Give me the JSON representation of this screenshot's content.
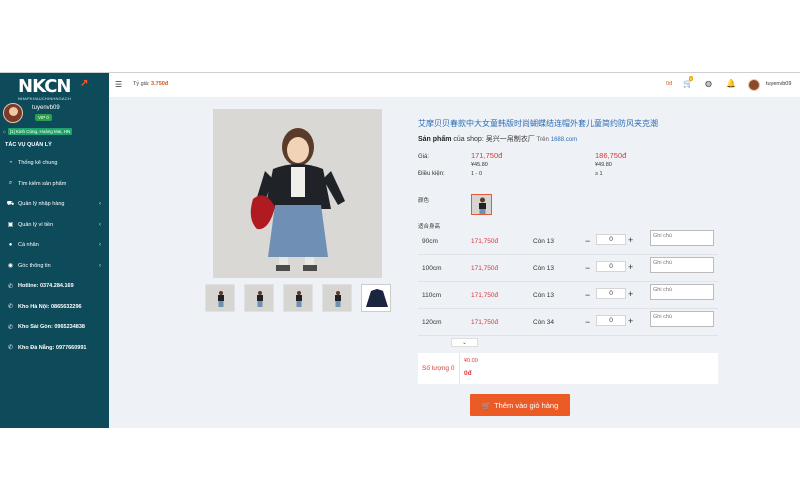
{
  "sidebar": {
    "logo_text": "NKCN",
    "logo_sub": "NHAPKHAUCHINHNGACH",
    "username": "tuyenvb09",
    "vip": "VIP 0",
    "location_tag": "[1] Kinh Cùng, Hoàng Mai, HN",
    "section_title": "TÁC VỤ QUẢN LÝ",
    "items": [
      {
        "label": "Thống kê chung",
        "icon": "dashboard-icon",
        "glyph": "◔",
        "chevron": false
      },
      {
        "label": "Tìm kiếm sản phẩm",
        "icon": "search-icon",
        "glyph": "⌕",
        "chevron": false
      },
      {
        "label": "Quản lý nhập hàng",
        "icon": "cart-icon",
        "glyph": "⛟",
        "chevron": true
      },
      {
        "label": "Quản lý ví tiền",
        "icon": "wallet-icon",
        "glyph": "▣",
        "chevron": true
      },
      {
        "label": "Cá nhân",
        "icon": "user-icon",
        "glyph": "●",
        "chevron": true
      },
      {
        "label": "Góc thông tin",
        "icon": "info-icon",
        "glyph": "◉",
        "chevron": true
      },
      {
        "label": "Hotline: 0374.284.169",
        "icon": "phone-icon",
        "glyph": "✆",
        "chevron": false
      },
      {
        "label": "Kho Hà Nội: 0865632296",
        "icon": "phone-icon",
        "glyph": "✆",
        "chevron": false
      },
      {
        "label": "Kho Sài Gòn: 0965234838",
        "icon": "phone-icon",
        "glyph": "✆",
        "chevron": false
      },
      {
        "label": "Kho Đà Nẵng: 0977660991",
        "icon": "phone-icon",
        "glyph": "✆",
        "chevron": false
      }
    ]
  },
  "topbar": {
    "rate_label": "Tỷ giá:",
    "rate_value": "3.750đ",
    "balance": "0đ",
    "cart_count": "0",
    "username": "tuyenvb09"
  },
  "product": {
    "title": "艾摩贝贝春款中大女童韩版时尚蝴蝶结连帽外套儿童简约防风夹克潮",
    "shop_label": "Sản phẩm",
    "shop_of": "của shop:",
    "shop_name": "吴兴一帛制衣厂",
    "platform_prefix": "Trên",
    "platform": "1688.com",
    "price_label": "Giá:",
    "condition_label": "Điều kiện:",
    "tier1": {
      "vnd": "171,750đ",
      "cny": "¥45.80",
      "cond": "1 - 0"
    },
    "tier2": {
      "vnd": "186,750đ",
      "cny": "¥49.80",
      "cond": "≥ 1"
    },
    "color_label": "颜色",
    "size_label": "适合身高",
    "sizes": [
      {
        "size": "90cm",
        "price": "171,750đ",
        "stock": "Còn 13",
        "qty": "0",
        "note_placeholder": "Ghi chú"
      },
      {
        "size": "100cm",
        "price": "171,750đ",
        "stock": "Còn 13",
        "qty": "0",
        "note_placeholder": "Ghi chú"
      },
      {
        "size": "110cm",
        "price": "171,750đ",
        "stock": "Còn 13",
        "qty": "0",
        "note_placeholder": "Ghi chú"
      },
      {
        "size": "120cm",
        "price": "171,750đ",
        "stock": "Còn 34",
        "qty": "0",
        "note_placeholder": "Ghi chú"
      }
    ],
    "summary_label": "Số lượng 0",
    "summary_cny": "¥0.00",
    "summary_vnd": "0đ",
    "add_to_cart": "Thêm vào giỏ hàng"
  },
  "colors": {
    "sidebar_bg": "#0d4a5a",
    "accent": "#ec5a25",
    "price_red": "#d9383a",
    "link_blue": "#2f6db5"
  }
}
